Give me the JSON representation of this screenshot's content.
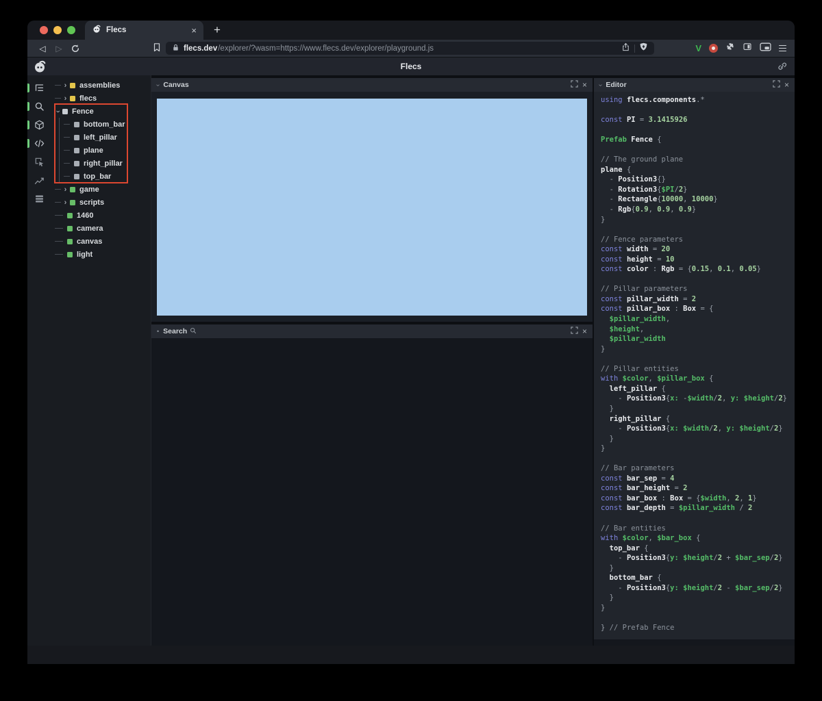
{
  "browser": {
    "tab_title": "Flecs",
    "url_domain": "flecs.dev",
    "url_rest": "/explorer/?wasm=https://www.flecs.dev/explorer/playground.js"
  },
  "glyphs": {
    "close": "×",
    "plus": "+",
    "chevron_right": "›",
    "back": "◁",
    "forward": "▷",
    "dot": "•",
    "v_extension": "V"
  },
  "header": {
    "title": "Flecs"
  },
  "panels": {
    "canvas": {
      "title": "Canvas"
    },
    "search": {
      "title": "Search"
    },
    "editor": {
      "title": "Editor"
    }
  },
  "colors": {
    "accent_green": "#6fce7d",
    "annotation_red": "#dd4730",
    "canvas_blue": "#a9cdee",
    "square_yellow": "#e3c54b",
    "square_green": "#67bd68",
    "square_gray": "#a9aeb5"
  },
  "sidebar_icons": [
    {
      "name": "tree-view-icon",
      "active": true
    },
    {
      "name": "search-icon",
      "active": true
    },
    {
      "name": "cube-icon",
      "active": true
    },
    {
      "name": "code-icon",
      "active": true
    },
    {
      "name": "inspect-icon",
      "active": false
    },
    {
      "name": "chart-icon",
      "active": false
    },
    {
      "name": "stats-icon",
      "active": false
    }
  ],
  "tree": {
    "items": [
      {
        "label": "assemblies",
        "kind": "collapsed",
        "color": "#e3c54b"
      },
      {
        "label": "flecs",
        "kind": "collapsed",
        "color": "#e3c54b"
      },
      {
        "label": "Fence",
        "kind": "expanded",
        "color": "#c7ccd2"
      },
      {
        "label": "bottom_bar",
        "kind": "child",
        "color": "#a9aeb5"
      },
      {
        "label": "left_pillar",
        "kind": "child",
        "color": "#a9aeb5"
      },
      {
        "label": "plane",
        "kind": "child",
        "color": "#a9aeb5"
      },
      {
        "label": "right_pillar",
        "kind": "child",
        "color": "#a9aeb5"
      },
      {
        "label": "top_bar",
        "kind": "child",
        "color": "#a9aeb5"
      },
      {
        "label": "game",
        "kind": "collapsed",
        "color": "#67bd68"
      },
      {
        "label": "scripts",
        "kind": "collapsed",
        "color": "#67bd68"
      },
      {
        "label": "1460",
        "kind": "leaf",
        "color": "#67bd68"
      },
      {
        "label": "camera",
        "kind": "leaf",
        "color": "#67bd68"
      },
      {
        "label": "canvas",
        "kind": "leaf",
        "color": "#67bd68"
      },
      {
        "label": "light",
        "kind": "leaf",
        "color": "#67bd68"
      }
    ]
  },
  "editor": {
    "code_lines": [
      [
        [
          "k",
          "using "
        ],
        [
          "w",
          "flecs.components"
        ],
        [
          "p",
          ".*"
        ]
      ],
      [],
      [
        [
          "k",
          "const "
        ],
        [
          "w",
          "PI "
        ],
        [
          "p",
          "= "
        ],
        [
          "n",
          "3.1415926"
        ]
      ],
      [],
      [
        [
          "v",
          "Prefab "
        ],
        [
          "w",
          "Fence "
        ],
        [
          "p",
          "{"
        ]
      ],
      [],
      [
        [
          "c",
          "// The ground plane"
        ]
      ],
      [
        [
          "w",
          "plane "
        ],
        [
          "p",
          "{"
        ]
      ],
      [
        [
          "p",
          "  - "
        ],
        [
          "w",
          "Position3"
        ],
        [
          "p",
          "{}"
        ]
      ],
      [
        [
          "p",
          "  - "
        ],
        [
          "w",
          "Rotation3"
        ],
        [
          "p",
          "{"
        ],
        [
          "v",
          "$PI"
        ],
        [
          "p",
          "/"
        ],
        [
          "n",
          "2"
        ],
        [
          "p",
          "}"
        ]
      ],
      [
        [
          "p",
          "  - "
        ],
        [
          "w",
          "Rectangle"
        ],
        [
          "p",
          "{"
        ],
        [
          "n",
          "10000"
        ],
        [
          "p",
          ", "
        ],
        [
          "n",
          "10000"
        ],
        [
          "p",
          "}"
        ]
      ],
      [
        [
          "p",
          "  - "
        ],
        [
          "w",
          "Rgb"
        ],
        [
          "p",
          "{"
        ],
        [
          "n",
          "0.9"
        ],
        [
          "p",
          ", "
        ],
        [
          "n",
          "0.9"
        ],
        [
          "p",
          ", "
        ],
        [
          "n",
          "0.9"
        ],
        [
          "p",
          "}"
        ]
      ],
      [
        [
          "p",
          "}"
        ]
      ],
      [],
      [
        [
          "c",
          "// Fence parameters"
        ]
      ],
      [
        [
          "k",
          "const "
        ],
        [
          "w",
          "width "
        ],
        [
          "p",
          "= "
        ],
        [
          "n",
          "20"
        ]
      ],
      [
        [
          "k",
          "const "
        ],
        [
          "w",
          "height "
        ],
        [
          "p",
          "= "
        ],
        [
          "n",
          "10"
        ]
      ],
      [
        [
          "k",
          "const "
        ],
        [
          "w",
          "color "
        ],
        [
          "p",
          ": "
        ],
        [
          "w",
          "Rgb "
        ],
        [
          "p",
          "= {"
        ],
        [
          "n",
          "0.15"
        ],
        [
          "p",
          ", "
        ],
        [
          "n",
          "0.1"
        ],
        [
          "p",
          ", "
        ],
        [
          "n",
          "0.05"
        ],
        [
          "p",
          "}"
        ]
      ],
      [],
      [
        [
          "c",
          "// Pillar parameters"
        ]
      ],
      [
        [
          "k",
          "const "
        ],
        [
          "w",
          "pillar_width "
        ],
        [
          "p",
          "= "
        ],
        [
          "n",
          "2"
        ]
      ],
      [
        [
          "k",
          "const "
        ],
        [
          "w",
          "pillar_box "
        ],
        [
          "p",
          ": "
        ],
        [
          "w",
          "Box "
        ],
        [
          "p",
          "= {"
        ]
      ],
      [
        [
          "v",
          "  $pillar_width"
        ],
        [
          "p",
          ","
        ]
      ],
      [
        [
          "v",
          "  $height"
        ],
        [
          "p",
          ","
        ]
      ],
      [
        [
          "v",
          "  $pillar_width"
        ]
      ],
      [
        [
          "p",
          "}"
        ]
      ],
      [],
      [
        [
          "c",
          "// Pillar entities"
        ]
      ],
      [
        [
          "k",
          "with "
        ],
        [
          "v",
          "$color"
        ],
        [
          "p",
          ", "
        ],
        [
          "v",
          "$pillar_box"
        ],
        [
          "p",
          " {"
        ]
      ],
      [
        [
          "w",
          "  left_pillar "
        ],
        [
          "p",
          "{"
        ]
      ],
      [
        [
          "p",
          "    - "
        ],
        [
          "w",
          "Position3"
        ],
        [
          "p",
          "{"
        ],
        [
          "v",
          "x:"
        ],
        [
          "p",
          " -"
        ],
        [
          "v",
          "$width"
        ],
        [
          "p",
          "/"
        ],
        [
          "n",
          "2"
        ],
        [
          "p",
          ", "
        ],
        [
          "v",
          "y:"
        ],
        [
          "p",
          " "
        ],
        [
          "v",
          "$height"
        ],
        [
          "p",
          "/"
        ],
        [
          "n",
          "2"
        ],
        [
          "p",
          "}"
        ]
      ],
      [
        [
          "p",
          "  }"
        ]
      ],
      [
        [
          "w",
          "  right_pillar "
        ],
        [
          "p",
          "{"
        ]
      ],
      [
        [
          "p",
          "    - "
        ],
        [
          "w",
          "Position3"
        ],
        [
          "p",
          "{"
        ],
        [
          "v",
          "x:"
        ],
        [
          "p",
          " "
        ],
        [
          "v",
          "$width"
        ],
        [
          "p",
          "/"
        ],
        [
          "n",
          "2"
        ],
        [
          "p",
          ", "
        ],
        [
          "v",
          "y:"
        ],
        [
          "p",
          " "
        ],
        [
          "v",
          "$height"
        ],
        [
          "p",
          "/"
        ],
        [
          "n",
          "2"
        ],
        [
          "p",
          "}"
        ]
      ],
      [
        [
          "p",
          "  }"
        ]
      ],
      [
        [
          "p",
          "}"
        ]
      ],
      [],
      [
        [
          "c",
          "// Bar parameters"
        ]
      ],
      [
        [
          "k",
          "const "
        ],
        [
          "w",
          "bar_sep "
        ],
        [
          "p",
          "= "
        ],
        [
          "n",
          "4"
        ]
      ],
      [
        [
          "k",
          "const "
        ],
        [
          "w",
          "bar_height "
        ],
        [
          "p",
          "= "
        ],
        [
          "n",
          "2"
        ]
      ],
      [
        [
          "k",
          "const "
        ],
        [
          "w",
          "bar_box "
        ],
        [
          "p",
          ": "
        ],
        [
          "w",
          "Box "
        ],
        [
          "p",
          "= {"
        ],
        [
          "v",
          "$width"
        ],
        [
          "p",
          ", "
        ],
        [
          "n",
          "2"
        ],
        [
          "p",
          ", "
        ],
        [
          "n",
          "1"
        ],
        [
          "p",
          "}"
        ]
      ],
      [
        [
          "k",
          "const "
        ],
        [
          "w",
          "bar_depth "
        ],
        [
          "p",
          "= "
        ],
        [
          "v",
          "$pillar_width"
        ],
        [
          "p",
          " / "
        ],
        [
          "n",
          "2"
        ]
      ],
      [],
      [
        [
          "c",
          "// Bar entities"
        ]
      ],
      [
        [
          "k",
          "with "
        ],
        [
          "v",
          "$color"
        ],
        [
          "p",
          ", "
        ],
        [
          "v",
          "$bar_box"
        ],
        [
          "p",
          " {"
        ]
      ],
      [
        [
          "w",
          "  top_bar "
        ],
        [
          "p",
          "{"
        ]
      ],
      [
        [
          "p",
          "    - "
        ],
        [
          "w",
          "Position3"
        ],
        [
          "p",
          "{"
        ],
        [
          "v",
          "y:"
        ],
        [
          "p",
          " "
        ],
        [
          "v",
          "$height"
        ],
        [
          "p",
          "/"
        ],
        [
          "n",
          "2"
        ],
        [
          "p",
          " + "
        ],
        [
          "v",
          "$bar_sep"
        ],
        [
          "p",
          "/"
        ],
        [
          "n",
          "2"
        ],
        [
          "p",
          "}"
        ]
      ],
      [
        [
          "p",
          "  }"
        ]
      ],
      [
        [
          "w",
          "  bottom_bar "
        ],
        [
          "p",
          "{"
        ]
      ],
      [
        [
          "p",
          "    - "
        ],
        [
          "w",
          "Position3"
        ],
        [
          "p",
          "{"
        ],
        [
          "v",
          "y:"
        ],
        [
          "p",
          " "
        ],
        [
          "v",
          "$height"
        ],
        [
          "p",
          "/"
        ],
        [
          "n",
          "2"
        ],
        [
          "p",
          " - "
        ],
        [
          "v",
          "$bar_sep"
        ],
        [
          "p",
          "/"
        ],
        [
          "n",
          "2"
        ],
        [
          "p",
          "}"
        ]
      ],
      [
        [
          "p",
          "  }"
        ]
      ],
      [
        [
          "p",
          "}"
        ]
      ],
      [],
      [
        [
          "p",
          "} "
        ],
        [
          "c",
          "// Prefab Fence"
        ]
      ]
    ]
  }
}
